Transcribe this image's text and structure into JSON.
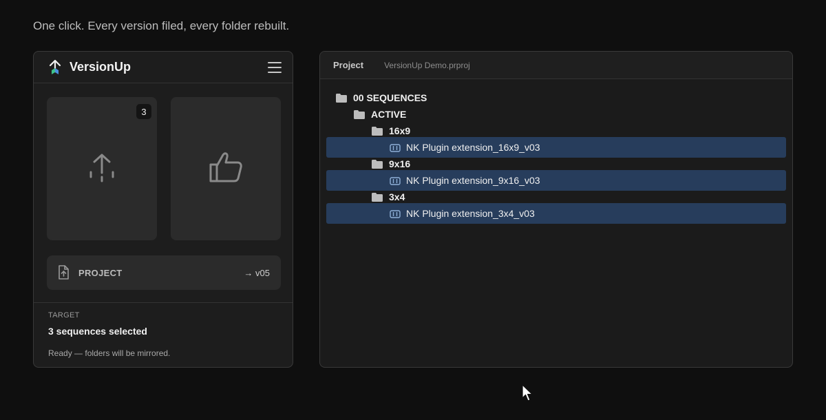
{
  "tagline": "One click. Every version filed, every folder rebuilt.",
  "left_panel": {
    "app_title": "VersionUp",
    "badge_count": "3",
    "project_row": {
      "label": "PROJECT",
      "version": "→ v05"
    },
    "target": {
      "label": "TARGET",
      "value": "3 sequences selected",
      "status": "Ready — folders will be mirrored."
    }
  },
  "right_panel": {
    "tab_project": "Project",
    "tab_file": "VersionUp Demo.prproj",
    "tree": {
      "root": "00 SEQUENCES",
      "active": "ACTIVE",
      "folder_16x9": "16x9",
      "seq_16x9": "NK Plugin extension_16x9_v03",
      "folder_9x16": "9x16",
      "seq_9x16": "NK Plugin extension_9x16_v03",
      "folder_3x4": "3x4",
      "seq_3x4": "NK Plugin extension_3x4_v03"
    }
  },
  "colors": {
    "background": "#0f0f0f",
    "panel": "#1d1d1d",
    "selection": "#273d5c",
    "accent_blue": "#4a8fe0",
    "accent_green": "#3fc28a"
  },
  "icons": [
    "versionup-logo-icon",
    "menu-icon",
    "upload-icon",
    "thumbs-up-icon",
    "file-upload-icon",
    "folder-icon",
    "sequence-icon",
    "mouse-cursor-icon"
  ]
}
